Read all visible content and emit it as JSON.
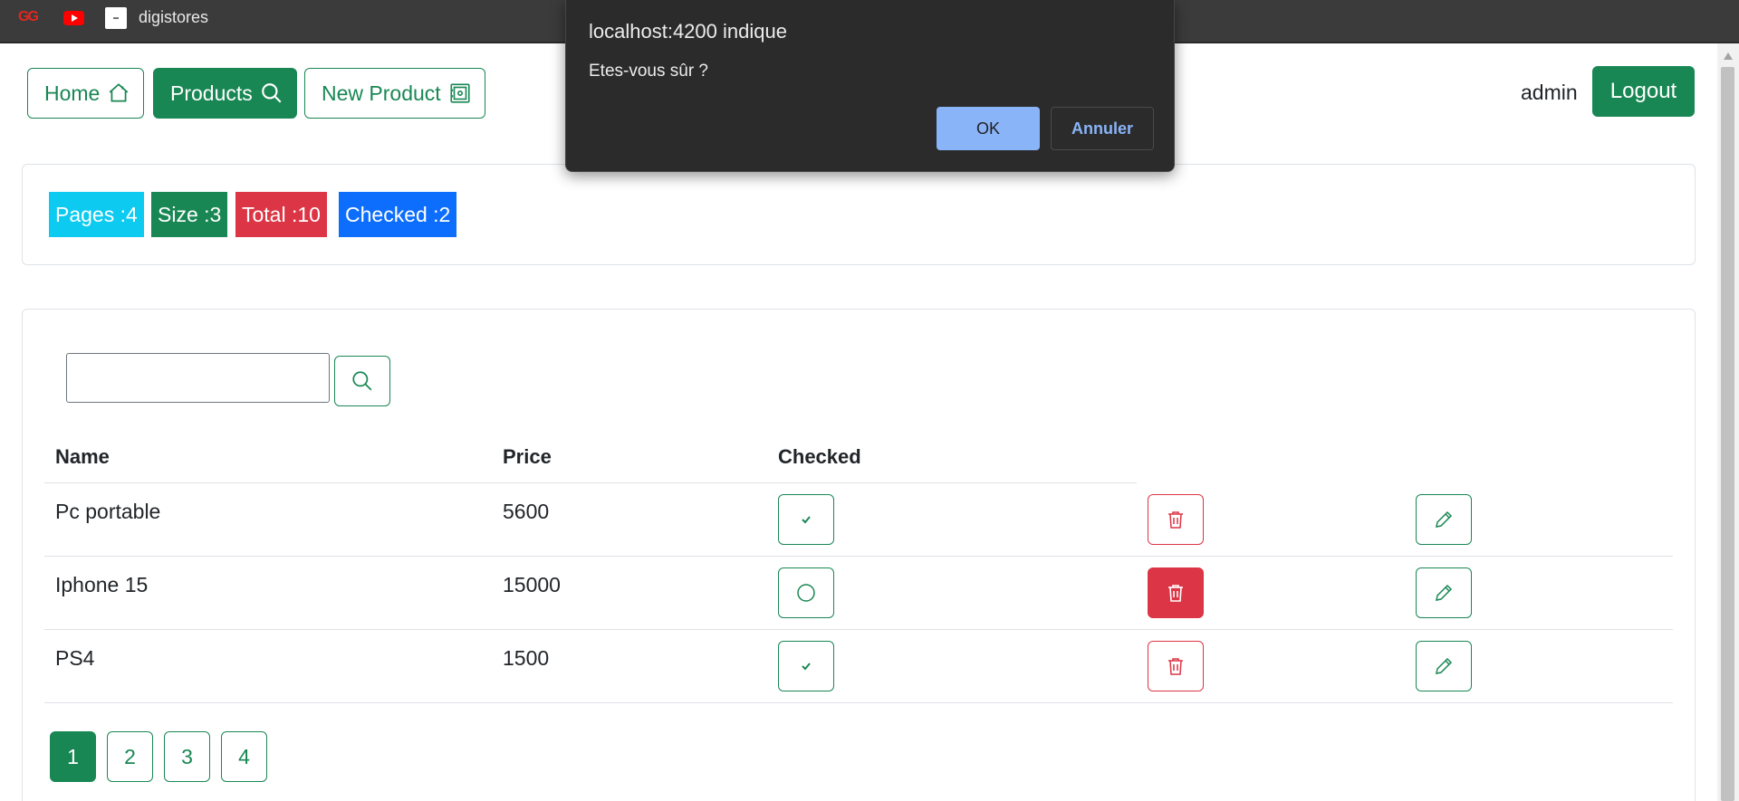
{
  "bookmarks": {
    "items": [
      {
        "icon": "gg-logo-icon",
        "label": ""
      },
      {
        "icon": "youtube-icon",
        "label": ""
      },
      {
        "icon": "digistores-favicon",
        "label": "digistores"
      }
    ]
  },
  "nav": {
    "home_label": "Home",
    "products_label": "Products",
    "new_product_label": "New Product",
    "user": "admin",
    "logout_label": "Logout"
  },
  "stats": {
    "pages": "Pages :4",
    "size": "Size :3",
    "total": "Total :10",
    "checked": "Checked :2"
  },
  "search": {
    "value": "",
    "placeholder": ""
  },
  "table": {
    "headers": [
      "Name",
      "Price",
      "Checked"
    ],
    "rows": [
      {
        "name": "Pc portable",
        "price": "5600",
        "checked": true,
        "delete_state": "outline"
      },
      {
        "name": "Iphone 15",
        "price": "15000",
        "checked": false,
        "delete_state": "filled"
      },
      {
        "name": "PS4",
        "price": "1500",
        "checked": true,
        "delete_state": "outline"
      }
    ]
  },
  "pagination": {
    "pages": [
      "1",
      "2",
      "3",
      "4"
    ],
    "current": "1"
  },
  "dialog": {
    "title": "localhost:4200 indique",
    "message": "Etes-vous sûr ?",
    "ok_label": "OK",
    "cancel_label": "Annuler"
  },
  "colors": {
    "success": "#198754",
    "danger": "#dc3545",
    "info": "#0dcaf0",
    "primary": "#0d6efd",
    "dialog_bg": "#2b2b2b",
    "dialog_accent": "#8ab4f8"
  }
}
